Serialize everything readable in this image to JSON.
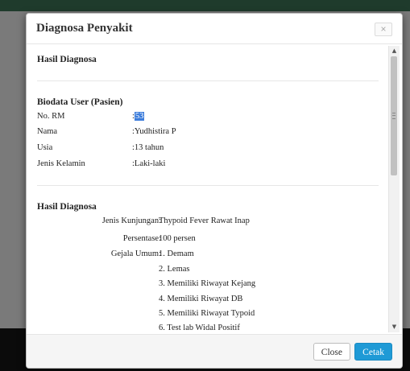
{
  "modal": {
    "title": "Diagnosa Penyakit",
    "close_x": "×"
  },
  "body": {
    "section1_title": "Hasil Diagnosa",
    "biodata": {
      "title": "Biodata User (Pasien)",
      "rows": [
        {
          "label": "No. RM",
          "sep": ":",
          "value": "53"
        },
        {
          "label": "Nama",
          "sep": ":",
          "value": "Yudhistira P"
        },
        {
          "label": "Usia",
          "sep": ":",
          "value": "13 tahun"
        },
        {
          "label": "Jenis Kelamin",
          "sep": ":",
          "value": "Laki-laki"
        }
      ]
    },
    "hasil": {
      "title": "Hasil Diagnosa",
      "jenis_label": "Jenis Kunjungan",
      "jenis_value": "Thypoid Fever Rawat Inap",
      "persentase_label": "Persentase",
      "persentase_value": "100 persen",
      "gejala_label": "Gejala Umum",
      "gejala": [
        "1. Demam",
        "2. Lemas",
        "3. Memiliki Riwayat Kejang",
        "4. Memiliki Riwayat DB",
        "5. Memiliki Riwayat Typoid",
        "6. Test lab Widal Positif"
      ]
    }
  },
  "footer": {
    "close_label": "Close",
    "print_label": "Cetak"
  },
  "colors": {
    "primary_button": "#1f9ad6",
    "selection_highlight": "#3d7ddb"
  }
}
